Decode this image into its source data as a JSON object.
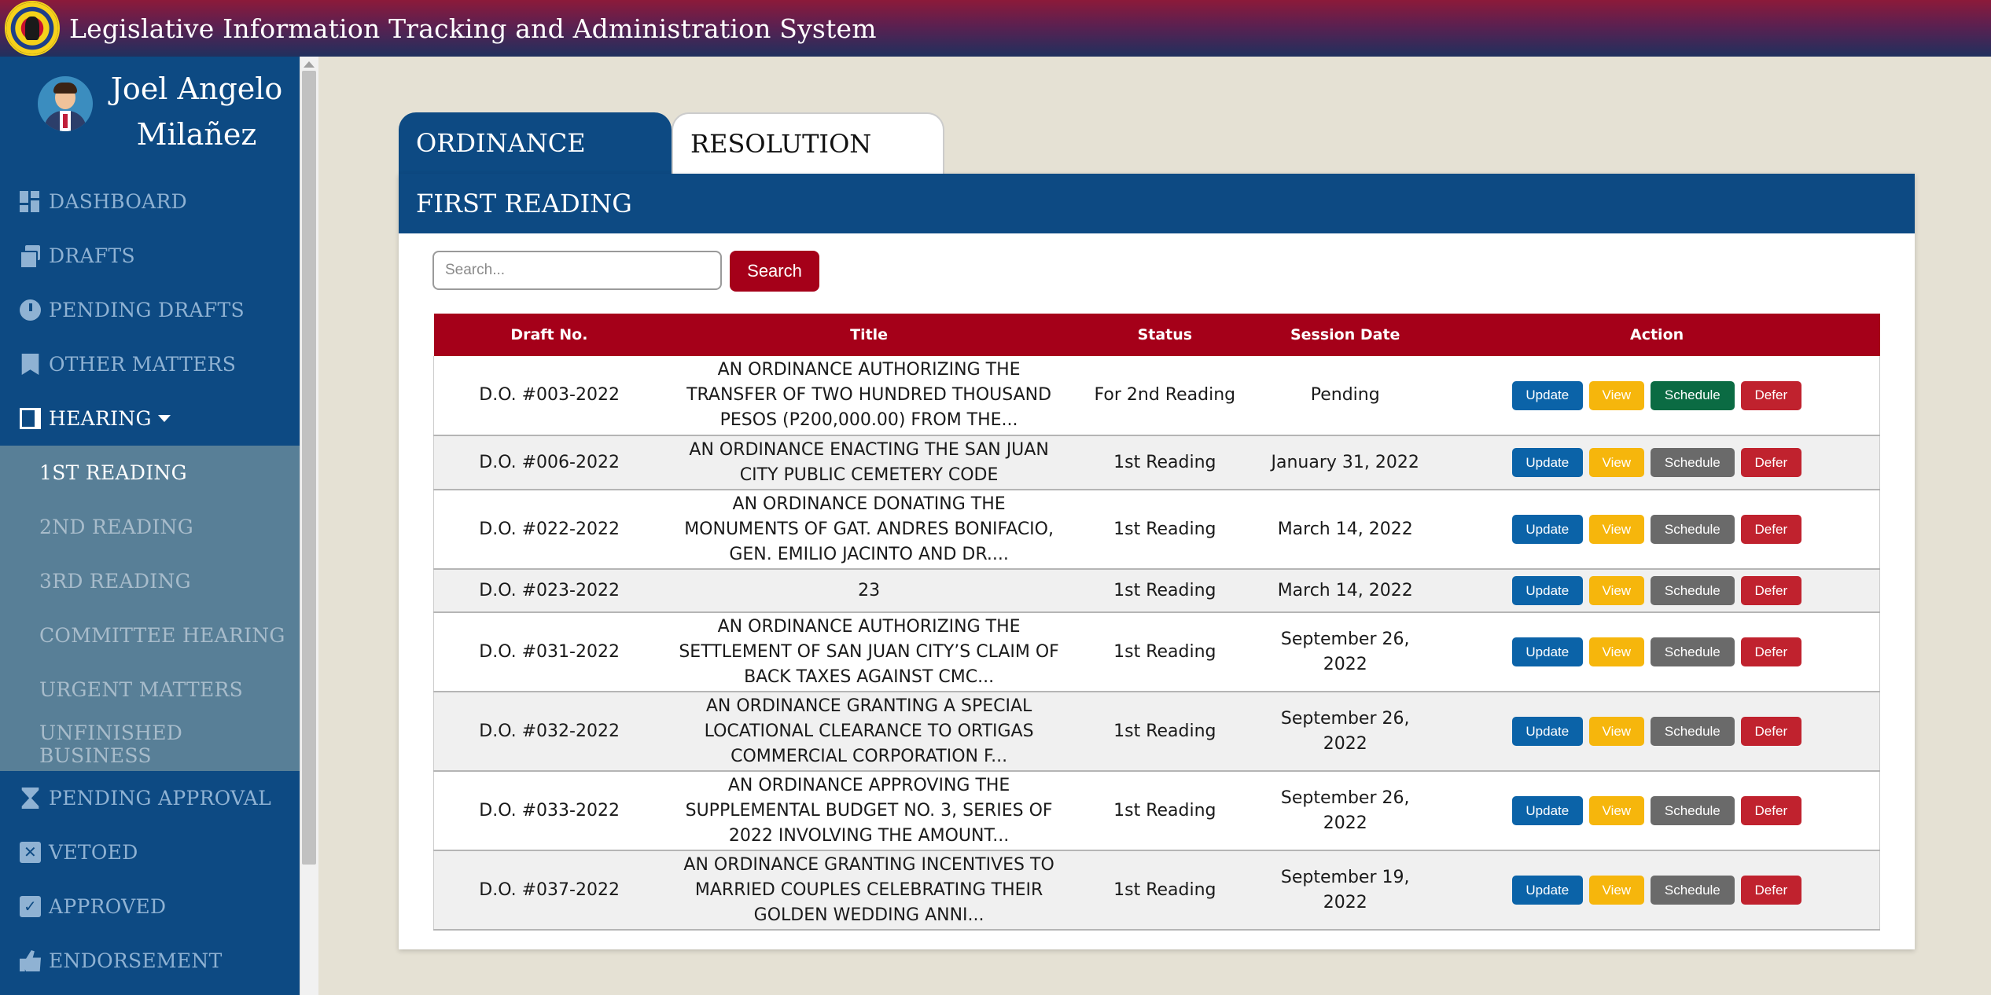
{
  "app": {
    "title": "Legislative Information Tracking and Administration System"
  },
  "user": {
    "name": "Joel Angelo Milañez"
  },
  "sidebar": {
    "items": [
      {
        "label": "DASHBOARD",
        "icon": "dashboard-icon"
      },
      {
        "label": "DRAFTS",
        "icon": "drafts-icon"
      },
      {
        "label": "PENDING DRAFTS",
        "icon": "clock-icon"
      },
      {
        "label": "OTHER MATTERS",
        "icon": "bookmark-icon"
      },
      {
        "label": "HEARING",
        "icon": "book-icon",
        "expanded": true
      }
    ],
    "submenu": [
      {
        "label": "1ST READING",
        "active": true
      },
      {
        "label": "2ND READING"
      },
      {
        "label": "3RD READING"
      },
      {
        "label": "COMMITTEE HEARING"
      },
      {
        "label": "URGENT MATTERS"
      },
      {
        "label": "UNFINISHED BUSINESS"
      }
    ],
    "items_after": [
      {
        "label": "PENDING APPROVAL",
        "icon": "hourglass-icon"
      },
      {
        "label": "VETOED",
        "icon": "x-box-icon"
      },
      {
        "label": "APPROVED",
        "icon": "check-box-icon"
      },
      {
        "label": "ENDORSEMENT",
        "icon": "thumbs-up-icon"
      }
    ]
  },
  "tabs": [
    {
      "label": "ORDINANCE",
      "active": true
    },
    {
      "label": "RESOLUTION",
      "active": false
    }
  ],
  "section": {
    "title": "FIRST READING"
  },
  "search": {
    "placeholder": "Search...",
    "value": "",
    "button": "Search"
  },
  "table": {
    "headers": [
      "Draft No.",
      "Title",
      "Status",
      "Session Date",
      "Action"
    ],
    "action_labels": {
      "update": "Update",
      "view": "View",
      "schedule": "Schedule",
      "defer": "Defer"
    },
    "rows": [
      {
        "draft_no": "D.O. #003-2022",
        "title": "AN ORDINANCE AUTHORIZING THE TRANSFER OF TWO HUNDRED THOUSAND PESOS (P200,000.00) FROM THE...",
        "status": "For 2nd Reading",
        "session_date": "Pending",
        "scheduled": true
      },
      {
        "draft_no": "D.O. #006-2022",
        "title": "AN ORDINANCE ENACTING THE SAN JUAN CITY PUBLIC CEMETERY CODE",
        "status": "1st Reading",
        "session_date": "January 31, 2022",
        "scheduled": false
      },
      {
        "draft_no": "D.O. #022-2022",
        "title": "AN ORDINANCE DONATING THE MONUMENTS OF GAT. ANDRES BONIFACIO, GEN. EMILIO JACINTO AND DR....",
        "status": "1st Reading",
        "session_date": "March 14, 2022",
        "scheduled": false
      },
      {
        "draft_no": "D.O. #023-2022",
        "title": "23",
        "status": "1st Reading",
        "session_date": "March 14, 2022",
        "scheduled": false
      },
      {
        "draft_no": "D.O. #031-2022",
        "title": "AN ORDINANCE AUTHORIZING THE SETTLEMENT OF SAN JUAN CITY’S CLAIM OF BACK TAXES AGAINST CMC...",
        "status": "1st Reading",
        "session_date": "September 26, 2022",
        "scheduled": false
      },
      {
        "draft_no": "D.O. #032-2022",
        "title": "AN ORDINANCE GRANTING A SPECIAL LOCATIONAL CLEARANCE TO ORTIGAS COMMERCIAL CORPORATION F...",
        "status": "1st Reading",
        "session_date": "September 26, 2022",
        "scheduled": false
      },
      {
        "draft_no": "D.O. #033-2022",
        "title": "AN ORDINANCE APPROVING THE SUPPLEMENTAL BUDGET NO. 3, SERIES OF 2022 INVOLVING THE AMOUNT...",
        "status": "1st Reading",
        "session_date": "September 26, 2022",
        "scheduled": false
      },
      {
        "draft_no": "D.O. #037-2022",
        "title": "AN ORDINANCE GRANTING INCENTIVES TO MARRIED COUPLES CELEBRATING THEIR GOLDEN WEDDING ANNI...",
        "status": "1st Reading",
        "session_date": "September 19, 2022",
        "scheduled": false
      }
    ]
  },
  "colors": {
    "sidebar": "#0d4a83",
    "submenu": "#587f97",
    "accent_red": "#a50019",
    "update": "#0b63a8",
    "view": "#f6b60c",
    "schedule_active": "#0b6b43",
    "schedule": "#6a6a6a",
    "defer": "#c0222e"
  }
}
